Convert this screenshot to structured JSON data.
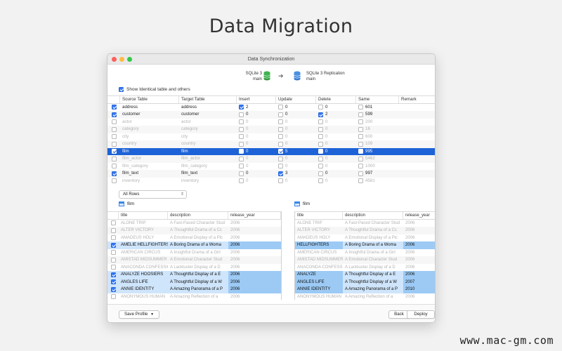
{
  "page_title": "Data Migration",
  "watermark": "www.mac-gm.com",
  "window": {
    "title": "Data Synchronization",
    "source_db": {
      "line1": "SQLite 3",
      "line2": "main"
    },
    "target_db": {
      "line1": "SQLite 3 Replication",
      "line2": "main"
    },
    "show_identical_label": "Show Identical table and others",
    "show_identical_checked": true
  },
  "sync_table": {
    "headers": [
      "Source Table",
      "Target Table",
      "Insert",
      "Update",
      "Delete",
      "Same",
      "Remark"
    ],
    "rows": [
      {
        "checked": true,
        "src": "address",
        "tgt": "address",
        "ins_c": true,
        "ins": "2",
        "upd_c": false,
        "upd": "0",
        "del_c": false,
        "del": "0",
        "same_c": false,
        "same": "601",
        "dim": false,
        "sel": false
      },
      {
        "checked": true,
        "src": "customer",
        "tgt": "customer",
        "ins_c": false,
        "ins": "0",
        "upd_c": false,
        "upd": "0",
        "del_c": true,
        "del": "2",
        "same_c": false,
        "same": "599",
        "dim": false,
        "sel": false
      },
      {
        "checked": false,
        "src": "actor",
        "tgt": "actor",
        "ins_c": false,
        "ins": "0",
        "upd_c": false,
        "upd": "0",
        "del_c": false,
        "del": "0",
        "same_c": false,
        "same": "200",
        "dim": true,
        "sel": false
      },
      {
        "checked": false,
        "src": "category",
        "tgt": "category",
        "ins_c": false,
        "ins": "0",
        "upd_c": false,
        "upd": "0",
        "del_c": false,
        "del": "0",
        "same_c": false,
        "same": "16",
        "dim": true,
        "sel": false
      },
      {
        "checked": false,
        "src": "city",
        "tgt": "city",
        "ins_c": false,
        "ins": "0",
        "upd_c": false,
        "upd": "0",
        "del_c": false,
        "del": "0",
        "same_c": false,
        "same": "600",
        "dim": true,
        "sel": false
      },
      {
        "checked": false,
        "src": "country",
        "tgt": "country",
        "ins_c": false,
        "ins": "0",
        "upd_c": false,
        "upd": "0",
        "del_c": false,
        "del": "0",
        "same_c": false,
        "same": "109",
        "dim": true,
        "sel": false
      },
      {
        "checked": true,
        "src": "film",
        "tgt": "film",
        "ins_c": false,
        "ins": "0",
        "upd_c": true,
        "upd": "5",
        "del_c": false,
        "del": "0",
        "same_c": false,
        "same": "995",
        "dim": false,
        "sel": true
      },
      {
        "checked": false,
        "src": "film_actor",
        "tgt": "film_actor",
        "ins_c": false,
        "ins": "0",
        "upd_c": false,
        "upd": "0",
        "del_c": false,
        "del": "0",
        "same_c": false,
        "same": "5462",
        "dim": true,
        "sel": false
      },
      {
        "checked": false,
        "src": "film_category",
        "tgt": "film_category",
        "ins_c": false,
        "ins": "0",
        "upd_c": false,
        "upd": "0",
        "del_c": false,
        "del": "0",
        "same_c": false,
        "same": "1000",
        "dim": true,
        "sel": false
      },
      {
        "checked": true,
        "src": "film_text",
        "tgt": "film_text",
        "ins_c": false,
        "ins": "0",
        "upd_c": true,
        "upd": "3",
        "del_c": false,
        "del": "0",
        "same_c": false,
        "same": "997",
        "dim": false,
        "sel": false
      },
      {
        "checked": false,
        "src": "inventory",
        "tgt": "inventory",
        "ins_c": false,
        "ins": "0",
        "upd_c": false,
        "upd": "0",
        "del_c": false,
        "del": "0",
        "same_c": false,
        "same": "4581",
        "dim": true,
        "sel": false
      }
    ]
  },
  "filter": {
    "selected": "All Rows"
  },
  "left_pane": {
    "table_name": "film",
    "headers": [
      "title",
      "description",
      "release_year"
    ],
    "rows": [
      {
        "checked": false,
        "title": "ALONE TRIP",
        "desc": "A Fast-Paced Character Stud",
        "year": "2006",
        "hl": false
      },
      {
        "checked": false,
        "title": "ALTER VICTORY",
        "desc": "A Thoughtful Drama of a Cc",
        "year": "2006",
        "hl": false
      },
      {
        "checked": false,
        "title": "AMADEUS HOLY",
        "desc": "A Emotional Display of a Pic",
        "year": "2006",
        "hl": false
      },
      {
        "checked": true,
        "title": "AMELIE HELLFIGHTERS",
        "desc": "A Boring Drama of a Woma",
        "year": "2006",
        "hl": true
      },
      {
        "checked": false,
        "title": "AMERICAN CIRCUS",
        "desc": "A Insightful Drama of a Girl",
        "year": "2006",
        "hl": false
      },
      {
        "checked": false,
        "title": "AMISTAD MIDSUMMER",
        "desc": "A Emotional Character Stud",
        "year": "2006",
        "hl": false
      },
      {
        "checked": false,
        "title": "ANACONDA CONFESSIO",
        "desc": "A Lackluster Display of a D",
        "year": "2006",
        "hl": false
      },
      {
        "checked": true,
        "title": "ANALYZE HOOSIERS",
        "desc": "A Thoughtful Display of a E",
        "year": "2006",
        "hl": true
      },
      {
        "checked": true,
        "title": "ANGLES LIFE",
        "desc": "A Thoughtful Display of a W",
        "year": "2006",
        "hl": true
      },
      {
        "checked": true,
        "title": "ANNIE IDENTITY",
        "desc": "A Amazing Panorama of a P",
        "year": "2006",
        "hl": true
      },
      {
        "checked": false,
        "title": "ANONYMOUS HUMAN",
        "desc": "A Amazing Reflection of a",
        "year": "2006",
        "hl": false
      }
    ]
  },
  "right_pane": {
    "table_name": "film",
    "headers": [
      "title",
      "description",
      "release_year"
    ],
    "rows": [
      {
        "title": "ALONE TRIP",
        "desc": "A Fast-Paced Character Stud",
        "year": "2006",
        "hl": false
      },
      {
        "title": "ALTER VICTORY",
        "desc": "A Thoughtful Drama of a Cc",
        "year": "2006",
        "hl": false
      },
      {
        "title": "AMADEUS HOLY",
        "desc": "A Emotional Display of a Pic",
        "year": "2006",
        "hl": false
      },
      {
        "title": "HELLFIGHTERS",
        "desc": "A Boring Drama of a Woma",
        "year": "2006",
        "hl": true
      },
      {
        "title": "AMERICAN CIRCUS",
        "desc": "A Insightful Drama of a Girl",
        "year": "2006",
        "hl": false
      },
      {
        "title": "AMISTAD MIDSUMMER",
        "desc": "A Emotional Character Stud",
        "year": "2006",
        "hl": false
      },
      {
        "title": "ANACONDA CONFESSIO",
        "desc": "A Lackluster Display of a D",
        "year": "2006",
        "hl": false
      },
      {
        "title": "ANALYZE",
        "desc": "A Thoughtful Display of a E",
        "year": "2006",
        "hl": true
      },
      {
        "title": "ANGLES LIFE",
        "desc": "A Thoughtful Display of a W",
        "year": "2007",
        "hl": true
      },
      {
        "title": "ANNIE IDENTITY",
        "desc": "A Amazing Panorama of a P",
        "year": "2010",
        "hl": true
      },
      {
        "title": "ANONYMOUS HUMAN",
        "desc": "A Amazing Reflection of a",
        "year": "2006",
        "hl": false
      }
    ]
  },
  "footer": {
    "save_profile_label": "Save Profile",
    "back_label": "Back",
    "deploy_label": "Deploy"
  },
  "colors": {
    "accent": "#1d62d6",
    "row_highlight": "#cfe5fb",
    "db_green": "#3fb34f",
    "db_blue": "#4a90e2"
  }
}
